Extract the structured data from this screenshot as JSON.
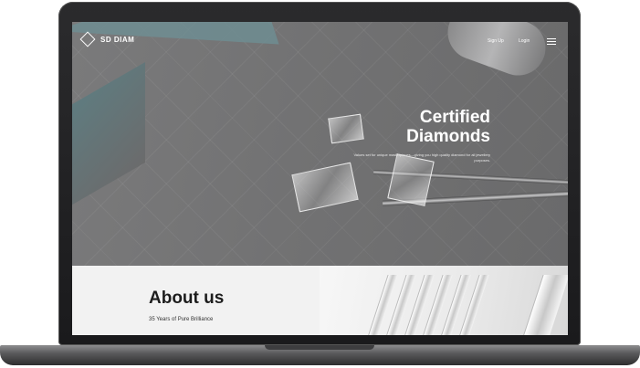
{
  "nav": {
    "logo_text": "SD DIAM",
    "links": [
      "Sign Up",
      "Login"
    ]
  },
  "hero": {
    "title_line1": "Certified",
    "title_line2": "Diamonds",
    "subtitle": "Values set for unique masterpieces—giving you high quality diamond for all jewellery purposes."
  },
  "about": {
    "title": "About us",
    "subtitle": "35 Years of Pure Brilliance"
  },
  "icons": [
    "diamond-logo-icon",
    "hamburger-menu-icon"
  ],
  "colors": {
    "hero_overlay": "#6f6f70",
    "about_bg": "#f2f2f2",
    "text_light": "#ffffff"
  }
}
